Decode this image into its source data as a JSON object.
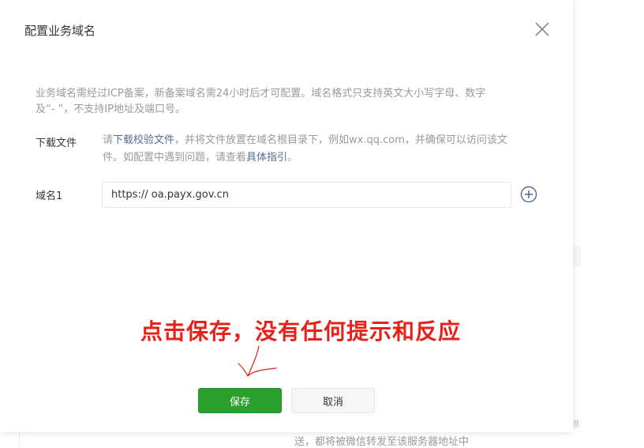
{
  "dialog": {
    "title": "配置业务域名",
    "close_icon": "close-icon"
  },
  "description": {
    "line1": "业务域名需经过ICP备案，新备案域名需24小时后才可配置。域名格式只支持英文大小写字母、数字",
    "line2": "及“- ”，不支持IP地址及端口号。"
  },
  "download": {
    "label": "下载文件",
    "prefix": "请",
    "link_download": "下载校验文件",
    "middle": "，并将文件放置在域名根目录下，例如wx.qq.com，并确保可以访问该文",
    "line2_prefix": "件。如配置中遇到问题，请查看",
    "link_guide": "具体指引",
    "suffix": "。"
  },
  "domain": {
    "label": "域名1",
    "protocol": "https://",
    "value": "oa.payx.gov.cn",
    "add_icon": "plus-circle-icon"
  },
  "annotation": {
    "text": "点击保存，没有任何提示和反应"
  },
  "buttons": {
    "save": "保存",
    "cancel": "取消"
  },
  "background": {
    "under_text": "送，都将被微信转发至该服务器地址中",
    "right_mark": "准"
  },
  "colors": {
    "primary_green": "#2ca02c",
    "link_blue": "#576b95",
    "annotation_red": "#e8201a",
    "muted_text": "#9a9a9a"
  }
}
